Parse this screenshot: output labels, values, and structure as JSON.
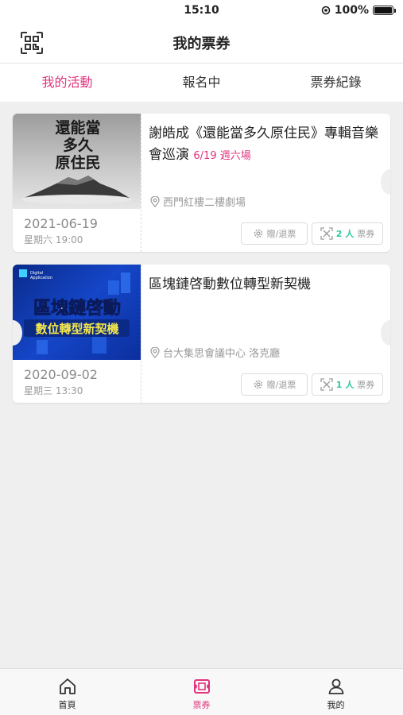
{
  "status_bar": {
    "time": "15:10",
    "battery": "100%"
  },
  "nav": {
    "title": "我的票券",
    "qr_icon": "qr-scan-icon"
  },
  "tabs": [
    {
      "label": "我的活動",
      "active": true
    },
    {
      "label": "報名中",
      "active": false
    },
    {
      "label": "票券紀錄",
      "active": false
    }
  ],
  "events": [
    {
      "image_text": [
        "還能當",
        "多久",
        "原住民"
      ],
      "title": "謝皓成《還能當多久原住民》專輯音樂會巡演",
      "title_tag": "6/19 週六場",
      "location": "西門紅樓二樓劇場",
      "date": "2021-06-19",
      "time": "星期六 19:00",
      "refund_label": "贈/退票",
      "tickets_count": "2 人",
      "tickets_label": "票券"
    },
    {
      "image_text": [
        "區塊鏈啓動",
        "數位轉型新契機"
      ],
      "title": "區塊鏈啓動數位轉型新契機",
      "title_tag": "",
      "location": "台大集思會議中心 洛克廳",
      "date": "2020-09-02",
      "time": "星期三 13:30",
      "refund_label": "贈/退票",
      "tickets_count": "1 人",
      "tickets_label": "票券"
    }
  ],
  "bottom_nav": [
    {
      "label": "首頁",
      "icon": "home-icon",
      "active": false
    },
    {
      "label": "票券",
      "icon": "ticket-icon",
      "active": true
    },
    {
      "label": "我的",
      "icon": "user-icon",
      "active": false
    }
  ],
  "colors": {
    "accent": "#e0347e",
    "ticket_count": "#2ec9a0",
    "background": "#efefef"
  }
}
